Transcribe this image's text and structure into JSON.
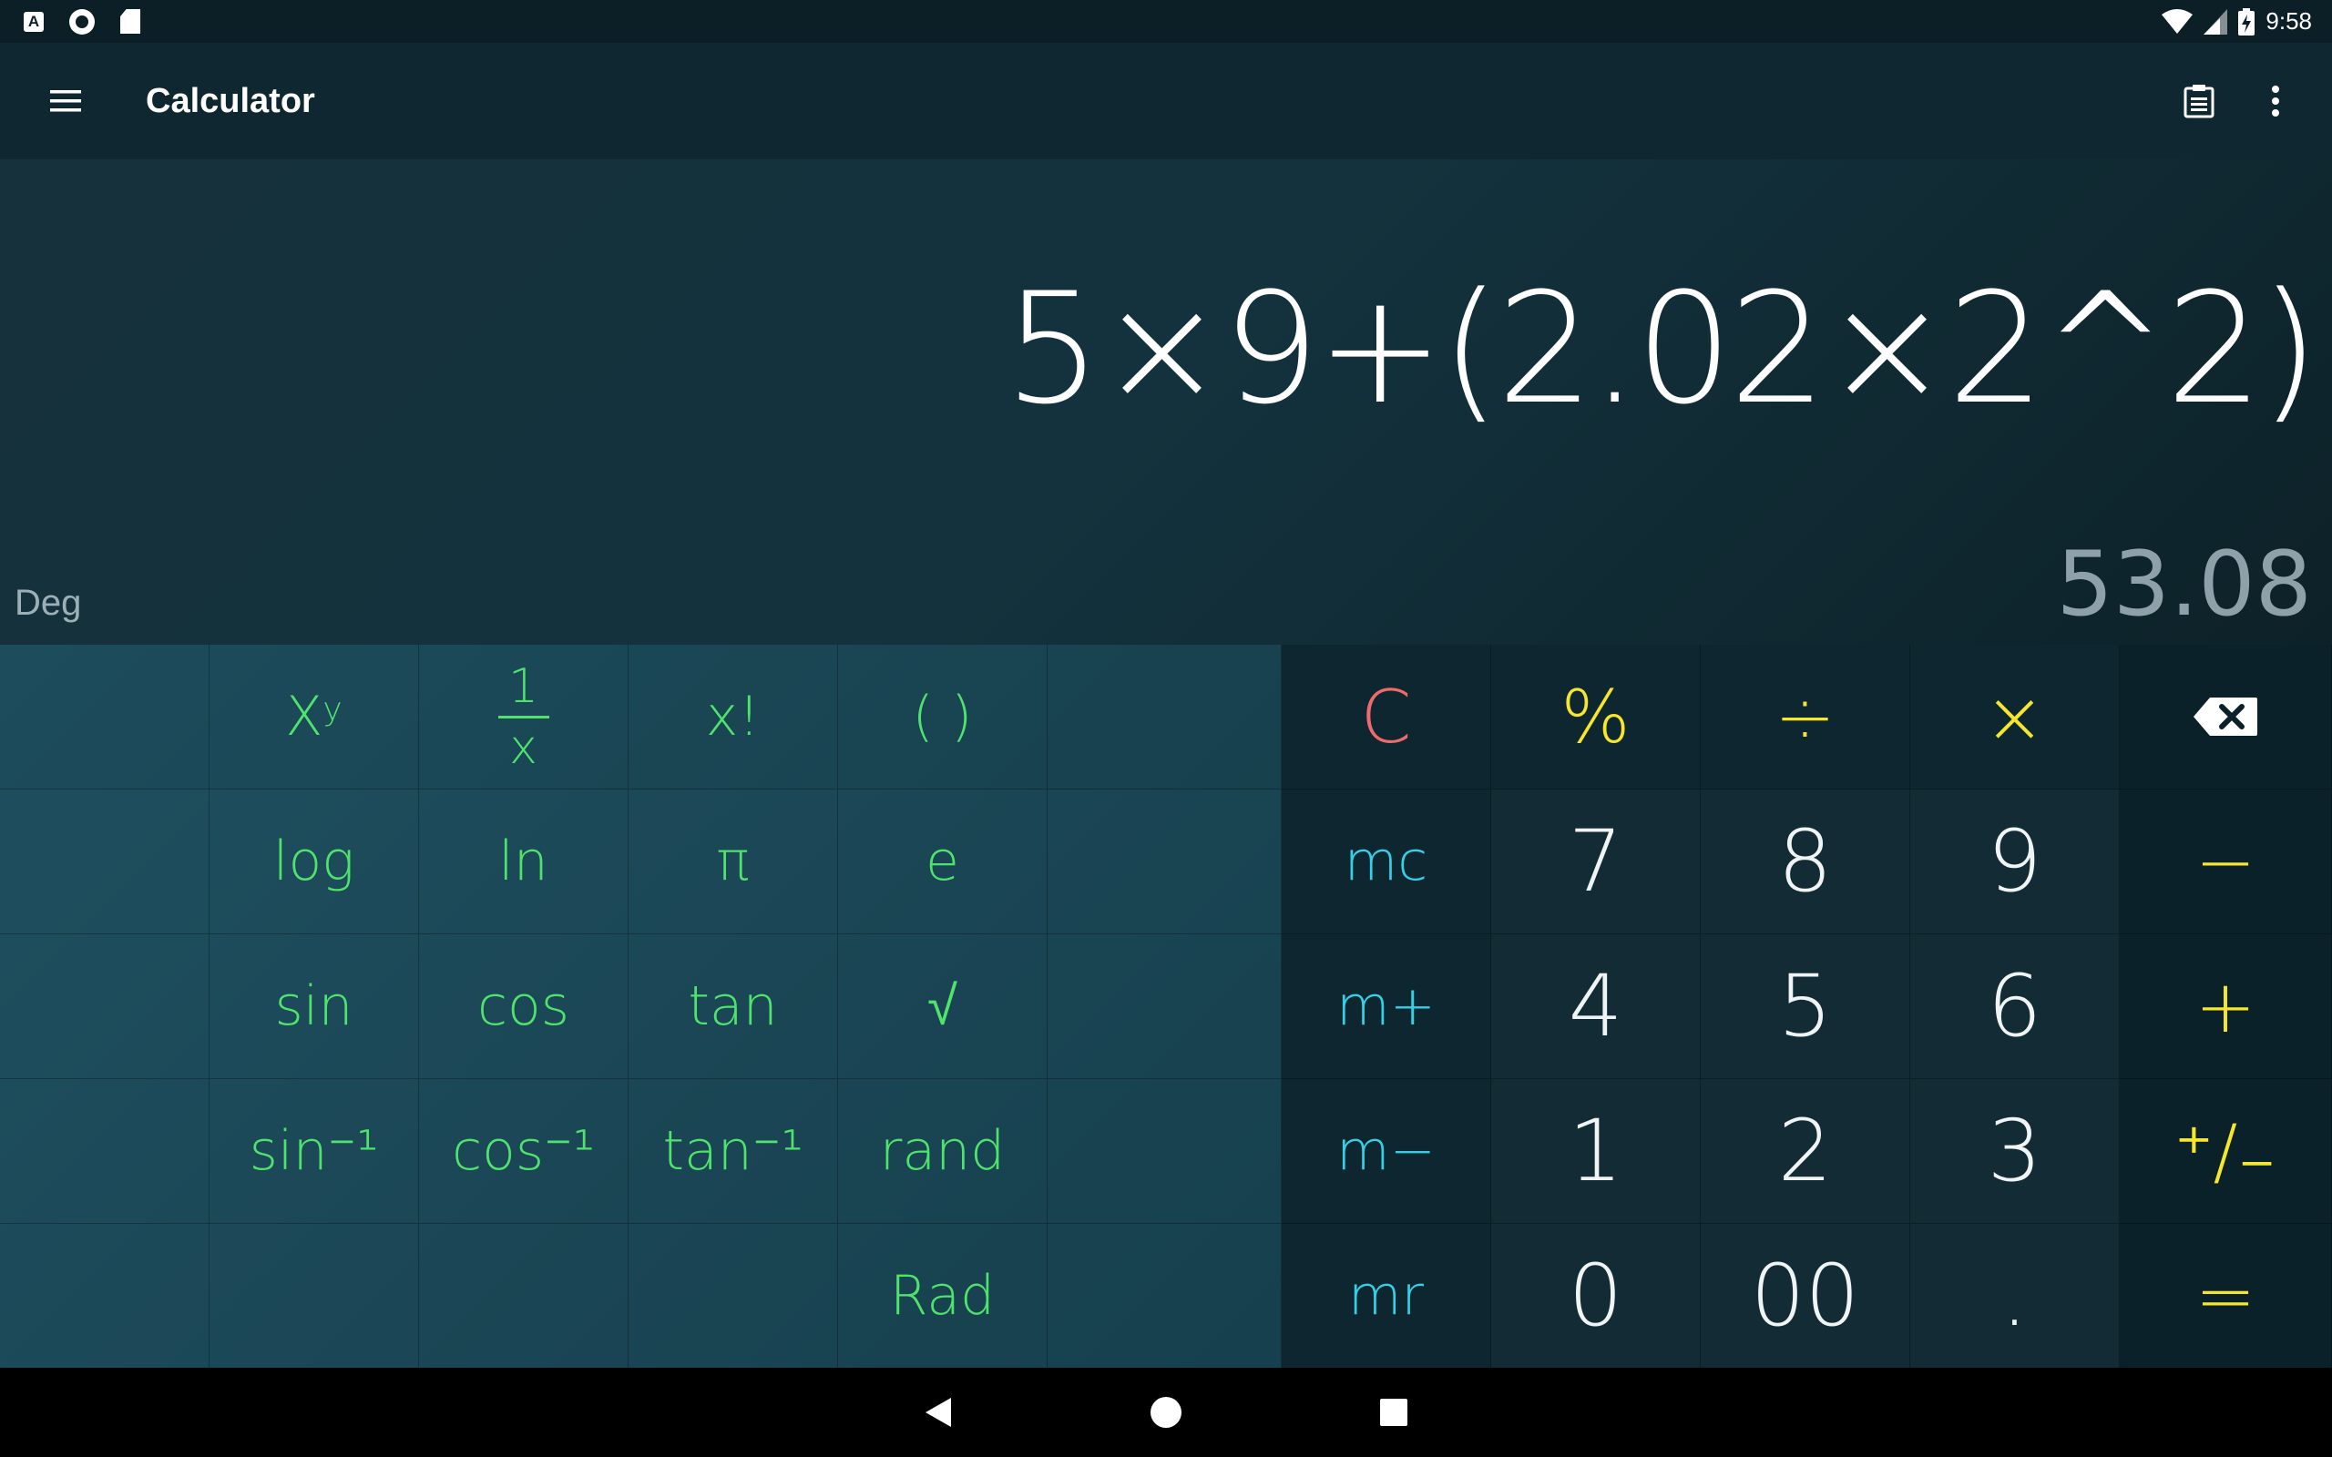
{
  "status_bar": {
    "time": "9:58",
    "left_icons": [
      "app-a-icon",
      "sync-circle-icon",
      "sd-card-icon"
    ],
    "right_icons": [
      "wifi-icon",
      "cell-signal-icon",
      "battery-charging-icon"
    ]
  },
  "app_bar": {
    "title": "Calculator",
    "icons": [
      "menu-icon",
      "history-clipboard-icon",
      "more-vert-icon"
    ]
  },
  "display": {
    "expression": "5×9+(2.02×2^2)",
    "result": "53.08",
    "angle_mode": "Deg"
  },
  "scientific_keys": {
    "row1": {
      "power": "X",
      "power_sup": "y",
      "reciprocal_num": "1",
      "reciprocal_den": "x",
      "factorial": "x!",
      "parens": "( )"
    },
    "row2": {
      "log": "log",
      "ln": "ln",
      "pi": "π",
      "e": "e"
    },
    "row3": {
      "sin": "sin",
      "cos": "cos",
      "tan": "tan",
      "sqrt": "√"
    },
    "row4": {
      "asin": "sin⁻¹",
      "acos": "cos⁻¹",
      "atan": "tan⁻¹",
      "rand": "rand"
    },
    "row5": {
      "rad": "Rad"
    }
  },
  "memory_keys": {
    "mc": "mc",
    "mplus": "m+",
    "mminus": "m−",
    "mr": "mr"
  },
  "number_keys": {
    "clear": "C",
    "percent": "%",
    "divide": "÷",
    "multiply": "×",
    "seven": "7",
    "eight": "8",
    "nine": "9",
    "minus": "−",
    "four": "4",
    "five": "5",
    "six": "6",
    "plus": "+",
    "one": "1",
    "two": "2",
    "three": "3",
    "plus_minus": "⁺∕₋",
    "zero": "0",
    "double_zero": "00",
    "decimal": ".",
    "equals": "="
  },
  "colors": {
    "scientific": "#4fe36c",
    "memory": "#35d0e6",
    "operator": "#f6e62c",
    "clear": "#ef6b6b",
    "digits": "#f0f4f5"
  },
  "nav_bar": {
    "icons": [
      "back-icon",
      "home-icon",
      "recents-icon"
    ]
  }
}
